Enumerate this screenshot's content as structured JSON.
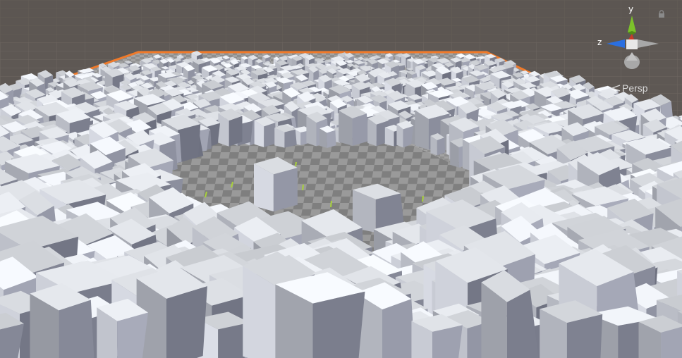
{
  "scene_view": {
    "projection_label": "Persp",
    "axis_labels": {
      "y": "y",
      "z": "z"
    },
    "colors": {
      "sky": "#5c5652",
      "ground_grid": "#6a635f",
      "selection_outline": "#f07a2a",
      "checker_light": "#9e9e9e",
      "checker_dark": "#7e7e7e",
      "axis_x": "#d43a2a",
      "axis_y": "#7cc22a",
      "axis_z": "#2a6fe0"
    },
    "icons": [
      "scene-gizmo-icon",
      "lock-icon",
      "perspective-icon"
    ]
  }
}
